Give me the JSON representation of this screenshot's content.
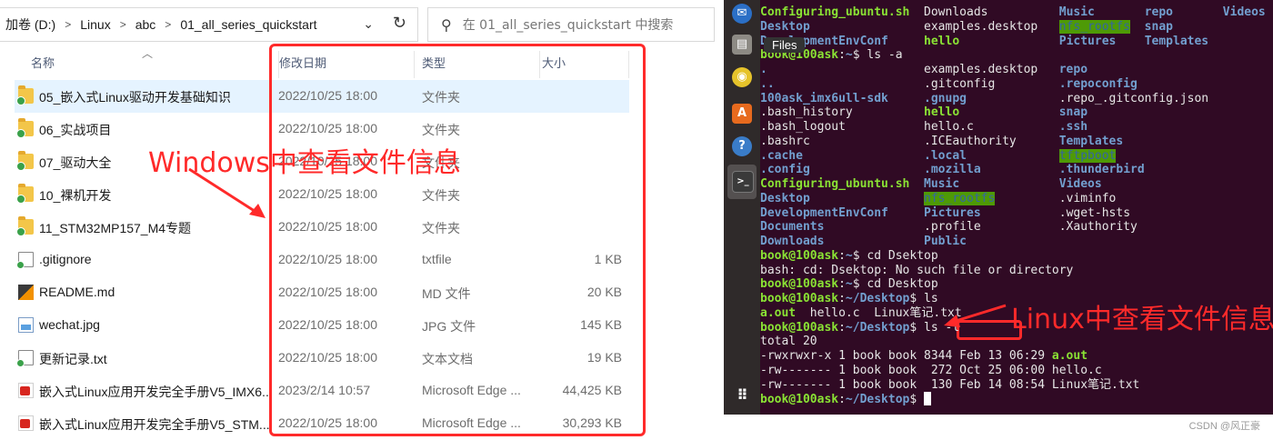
{
  "explorer": {
    "breadcrumb": [
      "加卷 (D:)",
      "Linux",
      "abc",
      "01_all_series_quickstart"
    ],
    "crumb_sep": ">",
    "search_placeholder": "在 01_all_series_quickstart 中搜索",
    "columns": {
      "name": "名称",
      "date": "修改日期",
      "type": "类型",
      "size": "大小"
    },
    "files": [
      {
        "name": "05_嵌入式Linux驱动开发基础知识",
        "date": "2022/10/25 18:00",
        "type": "文件夹",
        "size": "",
        "icon": "folder-icon"
      },
      {
        "name": "06_实战项目",
        "date": "2022/10/25 18:00",
        "type": "文件夹",
        "size": "",
        "icon": "folder-icon"
      },
      {
        "name": "07_驱动大全",
        "date": "2022/10/25 18:00",
        "type": "文件夹",
        "size": "",
        "icon": "folder-icon"
      },
      {
        "name": "10_裸机开发",
        "date": "2022/10/25 18:00",
        "type": "文件夹",
        "size": "",
        "icon": "folder-icon"
      },
      {
        "name": "11_STM32MP157_M4专题",
        "date": "2022/10/25 18:00",
        "type": "文件夹",
        "size": "",
        "icon": "folder-icon"
      },
      {
        "name": ".gitignore",
        "date": "2022/10/25 18:00",
        "type": "txtfile",
        "size": "1 KB",
        "icon": "text-file-icon"
      },
      {
        "name": "README.md",
        "date": "2022/10/25 18:00",
        "type": "MD 文件",
        "size": "20 KB",
        "icon": "markdown-file-icon"
      },
      {
        "name": "wechat.jpg",
        "date": "2022/10/25 18:00",
        "type": "JPG 文件",
        "size": "145 KB",
        "icon": "image-file-icon"
      },
      {
        "name": "更新记录.txt",
        "date": "2022/10/25 18:00",
        "type": "文本文档",
        "size": "19 KB",
        "icon": "text-file-icon"
      },
      {
        "name": "嵌入式Linux应用开发完全手册V5_IMX6...",
        "date": "2023/2/14 10:57",
        "type": "Microsoft Edge ...",
        "size": "44,425 KB",
        "icon": "pdf-file-icon"
      },
      {
        "name": "嵌入式Linux应用开发完全手册V5_STM...",
        "date": "2022/10/25 18:00",
        "type": "Microsoft Edge ...",
        "size": "30,293 KB",
        "icon": "pdf-file-icon"
      }
    ],
    "annotation": "Windows中查看文件信息"
  },
  "ubuntu": {
    "files_tooltip": "Files",
    "dock_icons": [
      "thunderbird-icon",
      "files-icon",
      "rhythmbox-icon",
      "software-center-icon",
      "help-icon",
      "terminal-icon",
      "show-apps-icon"
    ],
    "annotation": "Linux中查看文件信息",
    "terminal_lines": [
      [
        {
          "t": "Configuring_ubuntu.sh",
          "c": "g"
        },
        {
          "t": "  Downloads          "
        },
        {
          "t": "Music",
          "c": "b"
        },
        {
          "t": "       "
        },
        {
          "t": "repo",
          "c": "b"
        },
        {
          "t": "       "
        },
        {
          "t": "Videos",
          "c": "b"
        }
      ],
      [
        {
          "t": "Desktop",
          "c": "b"
        },
        {
          "t": "                examples.desktop   "
        },
        {
          "t": "nfs_rootfs",
          "c": "hl"
        },
        {
          "t": "  "
        },
        {
          "t": "snap",
          "c": "b"
        }
      ],
      [
        {
          "t": "DevelopmentEnvConf",
          "c": "b"
        },
        {
          "t": "     "
        },
        {
          "t": "hello",
          "c": "g"
        },
        {
          "t": "              "
        },
        {
          "t": "Pictures",
          "c": "b"
        },
        {
          "t": "    "
        },
        {
          "t": "Templates",
          "c": "b"
        }
      ],
      [
        {
          "t": "book@100ask",
          "c": "g"
        },
        {
          "t": ":"
        },
        {
          "t": "~",
          "c": "b"
        },
        {
          "t": "$ ls -a"
        }
      ],
      [
        {
          "t": ".",
          "c": "b"
        },
        {
          "t": "                      examples.desktop   "
        },
        {
          "t": "repo",
          "c": "b"
        }
      ],
      [
        {
          "t": "..",
          "c": "b"
        },
        {
          "t": "                     .gitconfig         "
        },
        {
          "t": ".repoconfig",
          "c": "b"
        }
      ],
      [
        {
          "t": "100ask_imx6ull-sdk",
          "c": "b"
        },
        {
          "t": "     "
        },
        {
          "t": ".gnupg",
          "c": "b"
        },
        {
          "t": "             .repo_.gitconfig.json"
        }
      ],
      [
        {
          "t": ".bash_history          "
        },
        {
          "t": "hello",
          "c": "g"
        },
        {
          "t": "              "
        },
        {
          "t": "snap",
          "c": "b"
        }
      ],
      [
        {
          "t": ".bash_logout           hello.c            "
        },
        {
          "t": ".ssh",
          "c": "b"
        }
      ],
      [
        {
          "t": ".bashrc                .ICEauthority      "
        },
        {
          "t": "Templates",
          "c": "b"
        }
      ],
      [
        {
          "t": ".cache",
          "c": "b"
        },
        {
          "t": "                 "
        },
        {
          "t": ".local",
          "c": "b"
        },
        {
          "t": "             "
        },
        {
          "t": "tftpboot",
          "c": "hl"
        }
      ],
      [
        {
          "t": ".config",
          "c": "b"
        },
        {
          "t": "                "
        },
        {
          "t": ".mozilla",
          "c": "b"
        },
        {
          "t": "           "
        },
        {
          "t": ".thunderbird",
          "c": "b"
        }
      ],
      [
        {
          "t": "Configuring_ubuntu.sh",
          "c": "g"
        },
        {
          "t": "  "
        },
        {
          "t": "Music",
          "c": "b"
        },
        {
          "t": "              "
        },
        {
          "t": "Videos",
          "c": "b"
        }
      ],
      [
        {
          "t": "Desktop",
          "c": "b"
        },
        {
          "t": "                "
        },
        {
          "t": "nfs_rootfs",
          "c": "hl"
        },
        {
          "t": "         .viminfo"
        }
      ],
      [
        {
          "t": "DevelopmentEnvConf",
          "c": "b"
        },
        {
          "t": "     "
        },
        {
          "t": "Pictures",
          "c": "b"
        },
        {
          "t": "           .wget-hsts"
        }
      ],
      [
        {
          "t": "Documents",
          "c": "b"
        },
        {
          "t": "              .profile           .Xauthority"
        }
      ],
      [
        {
          "t": "Downloads",
          "c": "b"
        },
        {
          "t": "              "
        },
        {
          "t": "Public",
          "c": "b"
        }
      ],
      [
        {
          "t": "book@100ask",
          "c": "g"
        },
        {
          "t": ":"
        },
        {
          "t": "~",
          "c": "b"
        },
        {
          "t": "$ cd Dsektop"
        }
      ],
      [
        {
          "t": "bash: cd: Dsektop: No such file or directory"
        }
      ],
      [
        {
          "t": "book@100ask",
          "c": "g"
        },
        {
          "t": ":"
        },
        {
          "t": "~",
          "c": "b"
        },
        {
          "t": "$ cd Desktop"
        }
      ],
      [
        {
          "t": "book@100ask",
          "c": "g"
        },
        {
          "t": ":"
        },
        {
          "t": "~/Desktop",
          "c": "b"
        },
        {
          "t": "$ ls"
        }
      ],
      [
        {
          "t": "a.out",
          "c": "g"
        },
        {
          "t": "  hello.c  Linux笔记.txt"
        }
      ],
      [
        {
          "t": "book@100ask",
          "c": "g"
        },
        {
          "t": ":"
        },
        {
          "t": "~/Desktop",
          "c": "b"
        },
        {
          "t": "$ ls -l"
        }
      ],
      [
        {
          "t": "total 20"
        }
      ],
      [
        {
          "t": "-rwxrwxr-x 1 book book 8344 Feb 13 06:29 "
        },
        {
          "t": "a.out",
          "c": "g"
        }
      ],
      [
        {
          "t": "-rw------- 1 book book  272 Oct 25 06:00 hello.c"
        }
      ],
      [
        {
          "t": "-rw------- 1 book book  130 Feb 14 08:54 Linux笔记.txt"
        }
      ],
      [
        {
          "t": "book@100ask",
          "c": "g"
        },
        {
          "t": ":"
        },
        {
          "t": "~/Desktop",
          "c": "b"
        },
        {
          "t": "$ "
        },
        {
          "t": "",
          "c": "cursor"
        }
      ]
    ]
  },
  "watermark": "CSDN @风正豪"
}
